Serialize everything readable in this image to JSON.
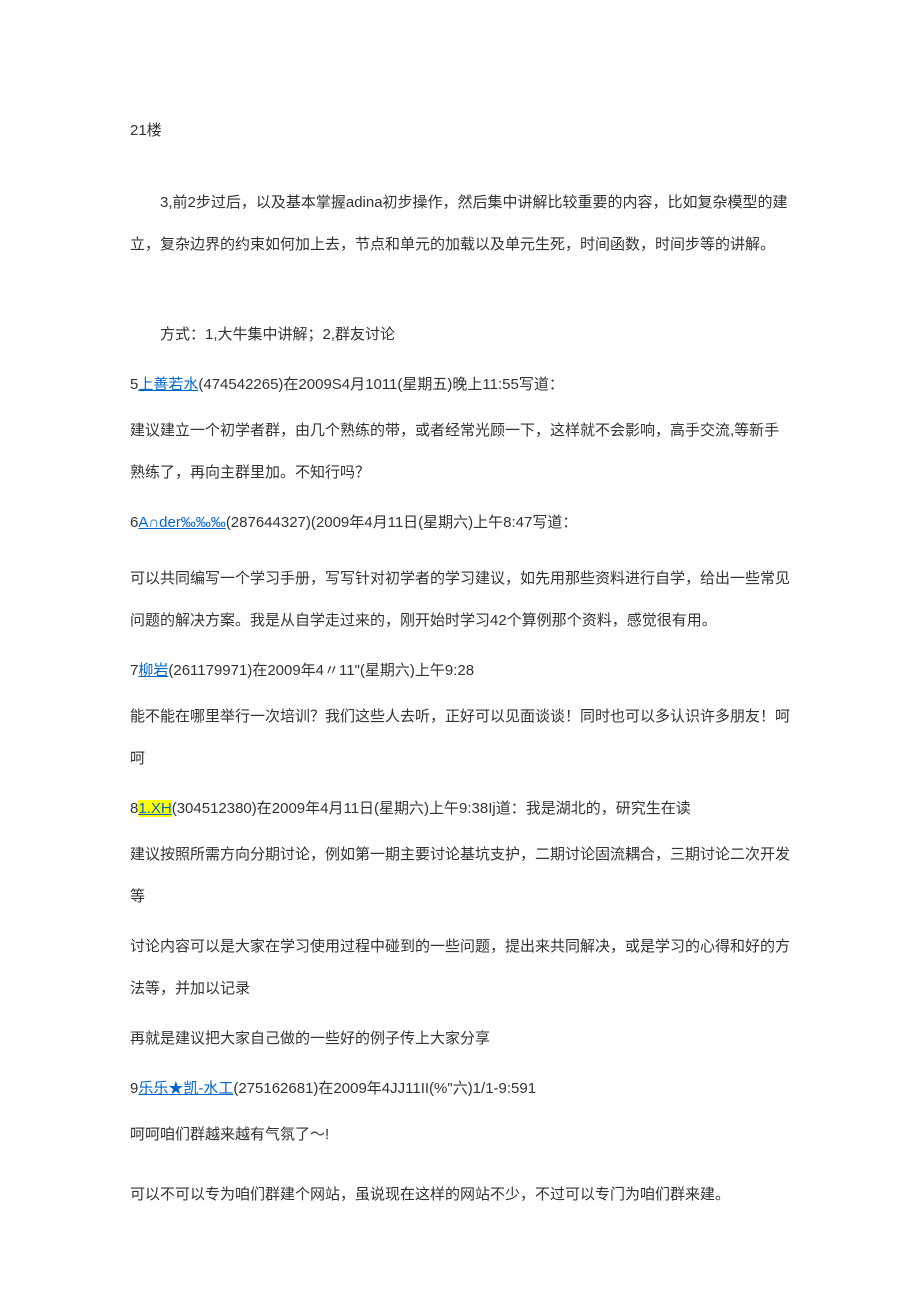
{
  "floor_label": "21楼",
  "entry3": {
    "body": "3,前2步过后，以及基本掌握adina初步操作，然后集中讲解比较重要的内容，比如复杂模型的建立，复杂边界的约束如何加上去，节点和单元的加载以及单元生死，时间函数，时间步等的讲解。",
    "method": "方式：1,大牛集中讲解；2,群友讨论"
  },
  "entry5": {
    "num": "5",
    "name": "上善若水",
    "meta": "(474542265)在2009S4月1011(星期五)晚上11:55写道：",
    "body": "建议建立一个初学者群，由几个熟练的带，或者经常光顾一下，这样就不会影响，高手交流,等新手熟练了，再向主群里加。不知行吗？"
  },
  "entry6": {
    "num": "6",
    "name": "A∩der‰‰‰",
    "meta": "(287644327)(2009年4月11日(星期六)上午8:47写道：",
    "body": "可以共同编写一个学习手册，写写针对初学者的学习建议，如先用那些资料进行自学，给出一些常见问题的解决方案。我是从自学走过来的，刚开始时学习42个算例那个资料，感觉很有用。"
  },
  "entry7": {
    "num": "7",
    "name": "柳岩",
    "meta": "(261179971)在2009年4〃11\"(星期六)上午9:28",
    "body": "能不能在哪里举行一次培训？我们这些人去听，正好可以见面谈谈！同时也可以多认识许多朋友！呵呵"
  },
  "entry8": {
    "num": "8",
    "name": "1.XH",
    "meta": "(304512380)在2009年4月11日(星期六)上午9:38Ij道：我是湖北的，研究生在读",
    "body1": "建议按照所需方向分期讨论，例如第一期主要讨论基坑支护，二期讨论固流耦合，三期讨论二次开发等",
    "body2": "讨论内容可以是大家在学习使用过程中碰到的一些问题，提出来共同解决，或是学习的心得和好的方法等，并加以记录",
    "body3": "再就是建议把大家自己做的一些好的例子传上大家分享"
  },
  "entry9": {
    "num": "9",
    "name": "乐乐★凯-水工",
    "meta": "(275162681)在2009年4JJ11II(%\"六)1/1-9:591",
    "body1": "呵呵咱们群越来越有气氛了～!",
    "body2": "可以不可以专为咱们群建个网站，虽说现在这样的网站不少，不过可以专门为咱们群来建。"
  }
}
